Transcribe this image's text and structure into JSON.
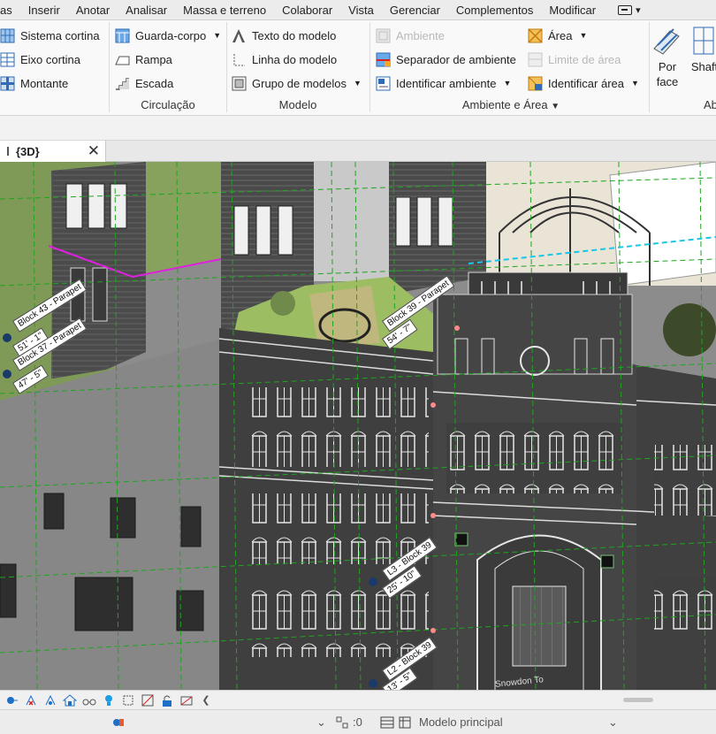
{
  "menu": {
    "items": [
      "as",
      "Inserir",
      "Anotar",
      "Analisar",
      "Massa e terreno",
      "Colaborar",
      "Vista",
      "Gerenciar",
      "Complementos",
      "Modificar"
    ]
  },
  "ribbon": {
    "construction": {
      "curtain_system": "Sistema cortina",
      "curtain_grid": "Eixo cortina",
      "mullion": "Montante"
    },
    "circulation": {
      "railing": "Guarda-corpo",
      "ramp": "Rampa",
      "stair": "Escada",
      "label": "Circulação"
    },
    "model": {
      "model_text": "Texto do modelo",
      "model_line": "Linha do modelo",
      "model_group": "Grupo de modelos",
      "label": "Modelo"
    },
    "room_area": {
      "room": "Ambiente",
      "room_separator": "Separador de ambiente",
      "tag_room": "Identificar ambiente",
      "area": "Área",
      "area_boundary": "Limite de área",
      "tag_area": "Identificar área",
      "label": "Ambiente e Área"
    },
    "opening": {
      "by_face_line1": "Por",
      "by_face_line2": "face",
      "shaft": "Shaft",
      "label_partial": "Ab"
    }
  },
  "view_tab": {
    "title": "{3D}",
    "close": "✕"
  },
  "tags": {
    "block43": "Block 43 - Parapet",
    "block43_elev": "51' - 1\"",
    "block37": "Block 37 - Parapet",
    "block37_elev": "47' - 5\"",
    "block39": "Block 39 - Parapet",
    "block39_elev": "54' - 7\"",
    "l3": "L3 - Block 39",
    "l3_elev": "25' - 10\"",
    "l2": "L2 - Block 39",
    "l2_elev": "13' - 5\"",
    "sign": "Snowdon To"
  },
  "status": {
    "worksharing_count": ":0",
    "workset": "Modelo principal"
  },
  "colors": {
    "grid_green": "#1fa51f",
    "selection_magenta": "#e020e0",
    "cyan_dash": "#19c6e6",
    "facade": "#3f3f3f"
  }
}
